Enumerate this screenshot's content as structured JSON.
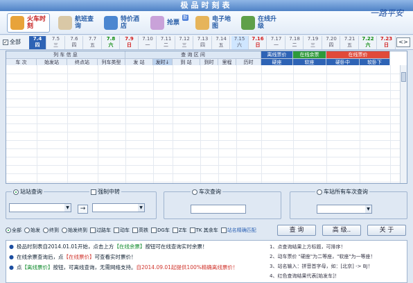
{
  "window": {
    "title": "极品时刻表"
  },
  "toolbar": [
    {
      "label": "火车时刻",
      "icon": "train-icon",
      "active": true
    },
    {
      "label": "航班查询",
      "icon": "plane-icon"
    },
    {
      "label": "特价酒店",
      "icon": "hotel-icon"
    },
    {
      "label": "抢票",
      "icon": "ticket-icon",
      "badge": "新"
    },
    {
      "label": "电子地图",
      "icon": "map-icon"
    },
    {
      "label": "在线升级",
      "icon": "upgrade-icon"
    }
  ],
  "logo": "一路平安",
  "dates": {
    "all_label": "全部",
    "items": [
      {
        "d": "7.4",
        "w": "四",
        "style": "sel"
      },
      {
        "d": "7.5",
        "w": "三"
      },
      {
        "d": "7.6",
        "w": "四"
      },
      {
        "d": "7.7",
        "w": "五"
      },
      {
        "d": "7.8",
        "w": "六",
        "style": "sat"
      },
      {
        "d": "7.9",
        "w": "日",
        "style": "sun"
      },
      {
        "d": "7.10",
        "w": "一"
      },
      {
        "d": "7.11",
        "w": "二"
      },
      {
        "d": "7.12",
        "w": "三"
      },
      {
        "d": "7.13",
        "w": "四"
      },
      {
        "d": "7.14",
        "w": "五"
      },
      {
        "d": "7.15",
        "w": "六",
        "style": "hl"
      },
      {
        "d": "7.16",
        "w": "日",
        "style": "sun"
      },
      {
        "d": "7.17",
        "w": "一"
      },
      {
        "d": "7.18",
        "w": "二"
      },
      {
        "d": "7.19",
        "w": "三"
      },
      {
        "d": "7.20",
        "w": "四"
      },
      {
        "d": "7.21",
        "w": "五"
      },
      {
        "d": "7.22",
        "w": "六",
        "style": "sat"
      },
      {
        "d": "7.23",
        "w": "日",
        "style": "sun"
      }
    ],
    "nav": "<>"
  },
  "grid": {
    "groups": [
      {
        "label": "列 车 信 息"
      },
      {
        "label": "查 询 区 间"
      },
      {
        "label": "离线票价",
        "color": "#2e63b5"
      },
      {
        "label": "在线余票",
        "color": "#2e9a3a"
      },
      {
        "label": "在线票价",
        "color": "#e04a3a"
      }
    ],
    "columns": [
      "车 次",
      "始发站",
      "终点站",
      "列车类型",
      "发 站",
      "发时↓",
      "到 站",
      "到时",
      "里程",
      "历时",
      "硬座",
      "软座",
      "硬卧中",
      "软卧下"
    ]
  },
  "filters": {
    "station": {
      "label": "站站查询"
    },
    "transfer": {
      "label": "强制中转"
    },
    "train": {
      "label": "车次查询"
    },
    "allstation": {
      "label": "车站所有车次查询"
    },
    "swap": "→"
  },
  "options": [
    {
      "label": "全部",
      "radio": true,
      "on": true
    },
    {
      "label": "始发",
      "radio": true
    },
    {
      "label": "终到",
      "radio": true
    },
    {
      "label": "始发终到",
      "radio": true
    },
    {
      "label": "过路车",
      "radio": false
    },
    {
      "label": "动车",
      "radio": false
    },
    {
      "label": "高铁",
      "radio": false
    },
    {
      "label": "DG车",
      "radio": false
    },
    {
      "label": "Z车",
      "radio": false
    },
    {
      "label": "TK 其余车",
      "radio": false
    },
    {
      "label": "站名精确匹配",
      "radio": false,
      "accent": true
    }
  ],
  "buttons": {
    "query": "查 询",
    "advanced": "高 级..",
    "about": "关 于"
  },
  "tips": [
    {
      "pre": "极品时刻表自2014.01.01开始，点击上方",
      "em": "【在线余票】",
      "post": "按钮可在线查询实时余票！",
      "em_color": "green"
    },
    {
      "pre": "在线余票查询后，点",
      "em": "【在线票价】",
      "post": "可查看实时票价！",
      "em_color": "red"
    },
    {
      "pre": "点",
      "em": "【离线票价】",
      "post": "按钮，可离线查询，无需网络支持。",
      "tail": "自2014.09.01起提供100%精确离线票价！",
      "em_color": "green"
    }
  ],
  "right_tips": [
    "1、点查询结果上方标题，可排序！",
    "2、动车票价 \"硬座\"为二等座，\"软座\"为一等座！",
    "3、站名输入：拼音首字母，如：[北京] -> BJ！",
    "4、红色查询结果代表[始发车]！"
  ]
}
